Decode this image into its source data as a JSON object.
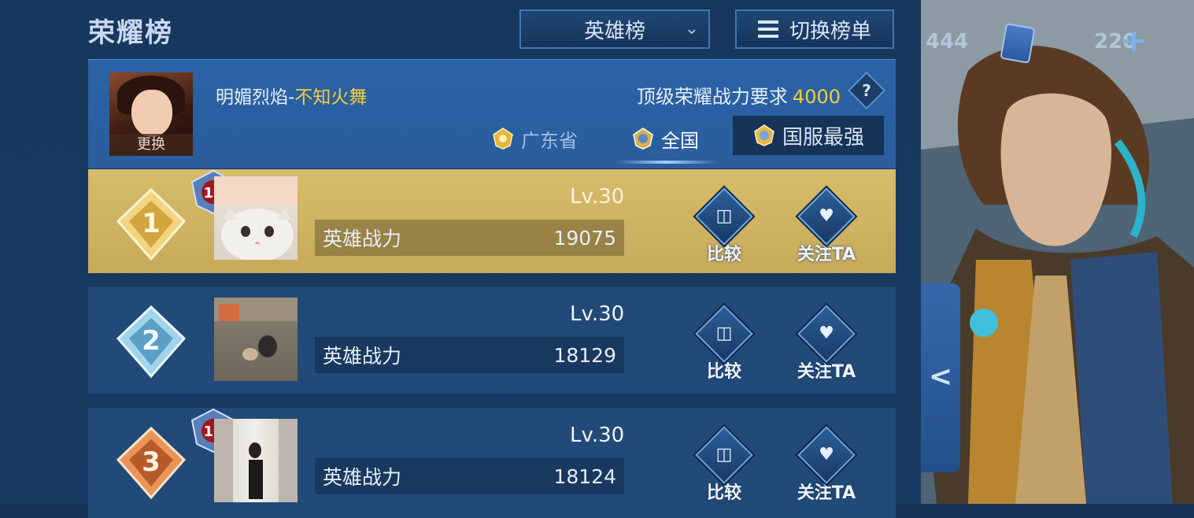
{
  "header": {
    "title": "荣耀榜",
    "dropdown_label": "英雄榜",
    "switch_label": "切换榜单"
  },
  "profile": {
    "player_name": "明媚烈焰",
    "separator": "-",
    "hero_name": "不知火舞",
    "change_label": "更换",
    "requirement_label": "顶级荣耀战力要求",
    "requirement_value": "4000",
    "help": "?"
  },
  "scope_tabs": [
    {
      "label": "广东省"
    },
    {
      "label": "全国"
    },
    {
      "label": "国服最强"
    }
  ],
  "rows": [
    {
      "rank": "1",
      "badge": "10",
      "level": "Lv.30",
      "power_label": "英雄战力",
      "power_value": "19075",
      "compare_label": "比较",
      "follow_label": "关注TA"
    },
    {
      "rank": "2",
      "level": "Lv.30",
      "power_label": "英雄战力",
      "power_value": "18129",
      "compare_label": "比较",
      "follow_label": "关注TA"
    },
    {
      "rank": "3",
      "badge": "10",
      "level": "Lv.30",
      "power_label": "英雄战力",
      "power_value": "18124",
      "compare_label": "比较",
      "follow_label": "关注TA"
    }
  ],
  "resources": {
    "coins": "444",
    "vouchers": "220"
  },
  "colors": {
    "accent_gold": "#f6cc3b",
    "panel_blue": "#214a78",
    "first_row_gold": "#d7bc6c"
  }
}
